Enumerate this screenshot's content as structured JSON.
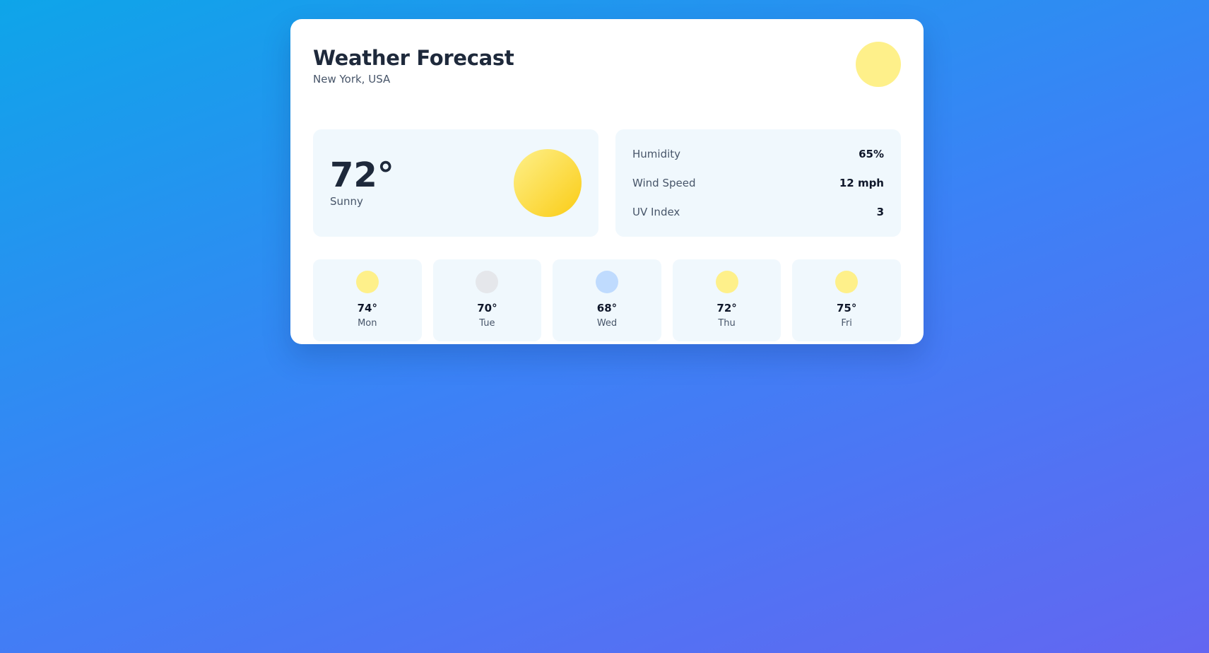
{
  "header": {
    "title": "Weather Forecast",
    "location": "New York, USA",
    "icon": "sun-icon",
    "icon_color": "#fef08a"
  },
  "current": {
    "temperature": "72°",
    "condition": "Sunny",
    "icon": "sun-icon"
  },
  "stats": [
    {
      "label": "Humidity",
      "value": "65%"
    },
    {
      "label": "Wind Speed",
      "value": "12 mph"
    },
    {
      "label": "UV Index",
      "value": "3"
    }
  ],
  "forecast": [
    {
      "day": "Mon",
      "temp": "74°",
      "icon": "sun-icon",
      "color": "#fef08a"
    },
    {
      "day": "Tue",
      "temp": "70°",
      "icon": "cloud-icon",
      "color": "#e5e7eb"
    },
    {
      "day": "Wed",
      "temp": "68°",
      "icon": "rain-icon",
      "color": "#bfdbfe"
    },
    {
      "day": "Thu",
      "temp": "72°",
      "icon": "sun-icon",
      "color": "#fef08a"
    },
    {
      "day": "Fri",
      "temp": "75°",
      "icon": "sun-icon",
      "color": "#fef08a"
    }
  ]
}
